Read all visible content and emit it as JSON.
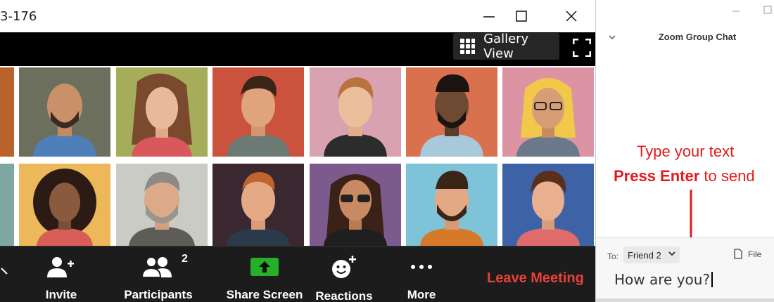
{
  "window": {
    "title": "3-176"
  },
  "view": {
    "gallery_label": "Gallery View"
  },
  "toolbar": {
    "invite_label": "Invite",
    "participants_label": "Participants",
    "participants_count": "2",
    "share_label": "Share Screen",
    "reactions_label": "Reactions",
    "more_label": "More",
    "leave_label": "Leave Meeting"
  },
  "chat": {
    "title": "Zoom Group Chat",
    "instruction_line1": "Type your text",
    "instruction_bold": "Press Enter",
    "instruction_rest": " to send",
    "to_label": "To:",
    "recipient": "Friend 2",
    "file_label": "File",
    "message_value": "How are you?"
  },
  "colors": {
    "leave": "#e8413a",
    "share_green": "#27b027",
    "instruction_red": "#e11b1b",
    "toolbar_bg": "#1c1c1c"
  }
}
